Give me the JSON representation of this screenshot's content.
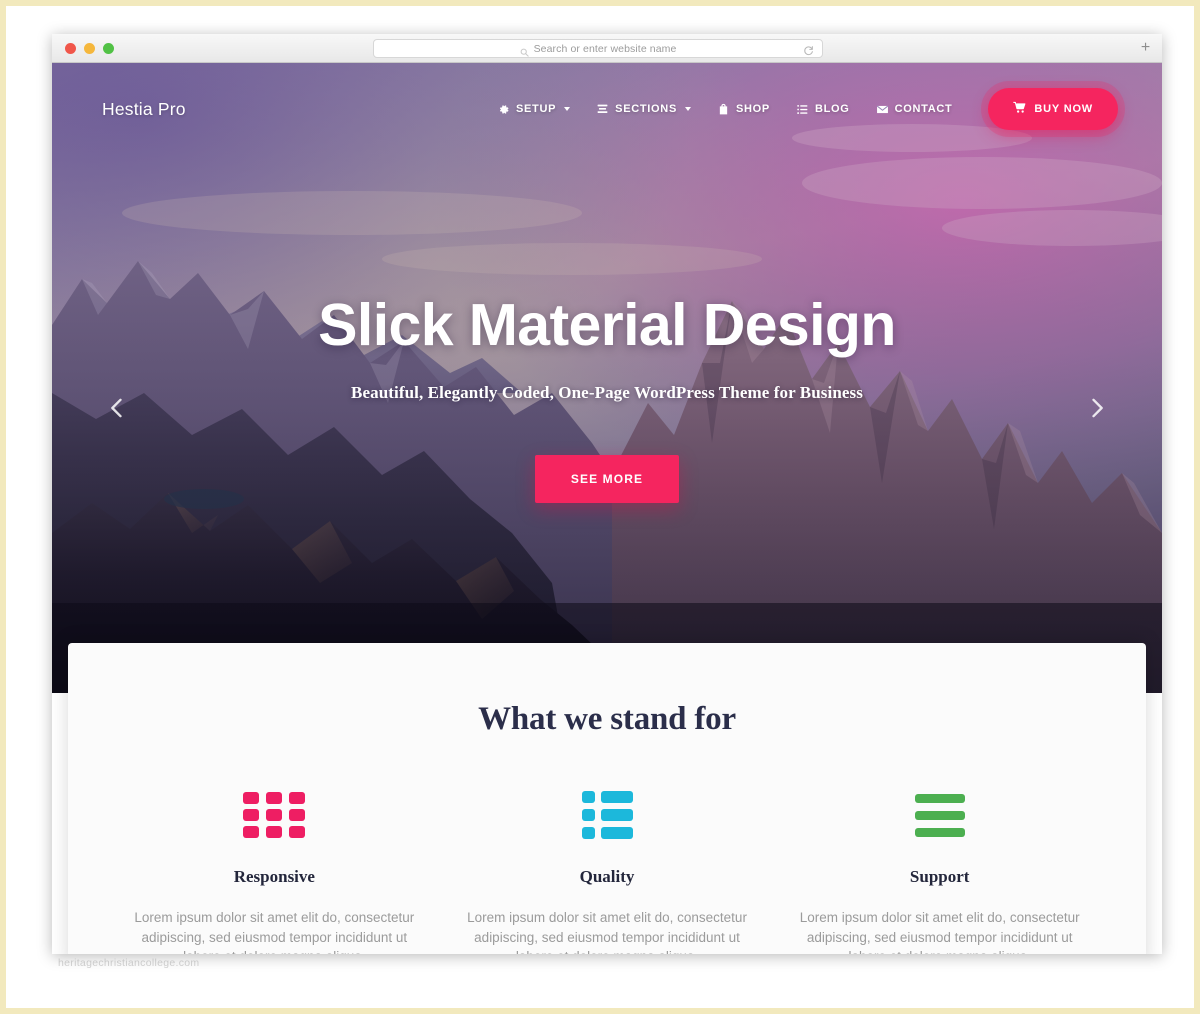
{
  "browser": {
    "search": {
      "placeholder": "Search or enter website name",
      "value": "",
      "search_icon": "search-icon",
      "reload_icon": "reload-icon"
    },
    "new_tab_label": "+",
    "traffic_lights": [
      "close",
      "minimize",
      "zoom"
    ]
  },
  "site": {
    "brand": "Hestia Pro",
    "nav": [
      {
        "label": "SETUP",
        "icon": "gear-icon",
        "has_dropdown": true
      },
      {
        "label": "SECTIONS",
        "icon": "sections-list-icon",
        "has_dropdown": true
      },
      {
        "label": "SHOP",
        "icon": "shopping-bag-icon",
        "has_dropdown": false
      },
      {
        "label": "BLOG",
        "icon": "list-icon",
        "has_dropdown": false
      },
      {
        "label": "CONTACT",
        "icon": "envelope-icon",
        "has_dropdown": false
      }
    ],
    "buy_now": {
      "label": "BUY NOW",
      "icon": "shopping-cart-icon"
    }
  },
  "hero": {
    "title": "Slick Material Design",
    "subtitle": "Beautiful, Elegantly Coded, One-Page WordPress Theme for Business",
    "cta_label": "SEE MORE",
    "prev_icon": "chevron-left-icon",
    "next_icon": "chevron-right-icon"
  },
  "features": {
    "heading": "What we stand for",
    "items": [
      {
        "title": "Responsive",
        "icon": "grid-icon",
        "description": "Lorem ipsum dolor sit amet elit do, consectetur adipiscing, sed eiusmod tempor incididunt ut labore et dolore magna aliqua."
      },
      {
        "title": "Quality",
        "icon": "list-blocks-icon",
        "description": "Lorem ipsum dolor sit amet elit do, consectetur adipiscing, sed eiusmod tempor incididunt ut labore et dolore magna aliqua."
      },
      {
        "title": "Support",
        "icon": "bars-icon",
        "description": "Lorem ipsum dolor sit amet elit do, consectetur adipiscing, sed eiusmod tempor incididunt ut labore et dolore magna aliqua."
      }
    ]
  },
  "watermark": "heritagechristiancollege.com",
  "colors": {
    "accent_pink": "#f5255f",
    "icon_pink": "#ee1e63",
    "icon_cyan": "#1cb8db",
    "icon_green": "#4caf50",
    "heading_navy": "#2b2e4a",
    "body_gray": "#9b9b9b",
    "frame_yellow": "#f2e9bd"
  }
}
